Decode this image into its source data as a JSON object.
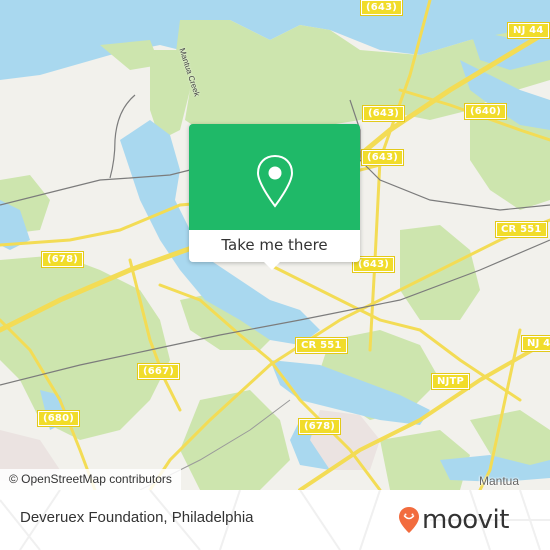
{
  "map": {
    "attribution": "© OpenStreetMap contributors",
    "place_labels": [
      {
        "id": "mantua",
        "text": "Mantua"
      }
    ],
    "water_labels": [
      {
        "id": "mantua-creek",
        "text": "Mantua Creek"
      }
    ],
    "road_shields": [
      {
        "id": "643-top",
        "text": "(643)"
      },
      {
        "id": "nj44-top",
        "text": "NJ 44"
      },
      {
        "id": "643-mid1",
        "text": "(643)"
      },
      {
        "id": "640",
        "text": "(640)"
      },
      {
        "id": "643-mid2",
        "text": "(643)"
      },
      {
        "id": "cr551-right",
        "text": "CR 551"
      },
      {
        "id": "678-left",
        "text": "(678)"
      },
      {
        "id": "643-lower",
        "text": "(643)"
      },
      {
        "id": "cr551-center",
        "text": "CR 551"
      },
      {
        "id": "nj44-right",
        "text": "NJ 4"
      },
      {
        "id": "667",
        "text": "(667)"
      },
      {
        "id": "njtp",
        "text": "NJTP"
      },
      {
        "id": "680",
        "text": "(680)"
      },
      {
        "id": "678-lower",
        "text": "(678)"
      }
    ],
    "colors": {
      "land": "#f2f1ec",
      "water": "#a9d8ef",
      "park": "#cde5ae",
      "road": "#f3dc55",
      "shield": "#f1dc2a",
      "rail": "#7c7c7c"
    }
  },
  "popup": {
    "action_label": "Take me there",
    "icon": "map-pin-icon",
    "color": "#1fb968"
  },
  "footer": {
    "place_name": "Deveruex Foundation, Philadelphia",
    "brand": "moovit",
    "brand_color": "#f26c3e"
  }
}
